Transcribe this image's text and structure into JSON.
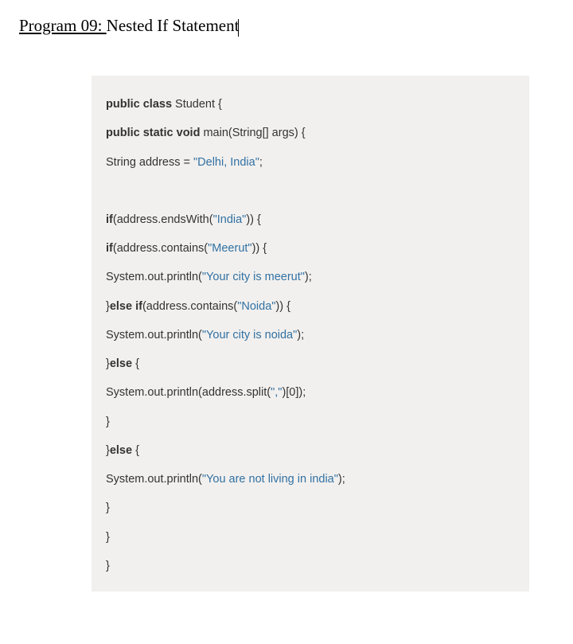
{
  "title": {
    "program": "Program 09: ",
    "rest": " Nested If Statement"
  },
  "code": {
    "l1": {
      "kw1": "public class",
      "text": " Student {"
    },
    "l2": {
      "kw1": "public static void",
      "text": " main(String[] args) {"
    },
    "l3": {
      "pre": "String address = ",
      "str": "\"Delhi, India\"",
      "post": ";"
    },
    "l4": {
      "kw1": "if",
      "pre": "(address.endsWith(",
      "str": "\"India\"",
      "post": ")) {"
    },
    "l5": {
      "kw1": "if",
      "pre": "(address.contains(",
      "str": "\"Meerut\"",
      "post": ")) {"
    },
    "l6": {
      "pre": "System.out.println(",
      "str": "\"Your city is meerut\"",
      "post": ");"
    },
    "l7": {
      "pre": "}",
      "kw1": "else if",
      "mid": "(address.contains(",
      "str": "\"Noida\"",
      "post": ")) {"
    },
    "l8": {
      "pre": "System.out.println(",
      "str": "\"Your city is noida\"",
      "post": ");"
    },
    "l9": {
      "pre": "}",
      "kw1": "else",
      "post": " {"
    },
    "l10": {
      "pre": "System.out.println(address.split(",
      "str": "\",\"",
      "mid": ")[",
      "num": "0",
      "post": "]);"
    },
    "l11": "}",
    "l12": {
      "pre": "}",
      "kw1": "else",
      "post": " {"
    },
    "l13": {
      "pre": "System.out.println(",
      "str": "\"You are not living in india\"",
      "post": ");"
    },
    "l14": "}",
    "l15": "}",
    "l16": "}"
  }
}
